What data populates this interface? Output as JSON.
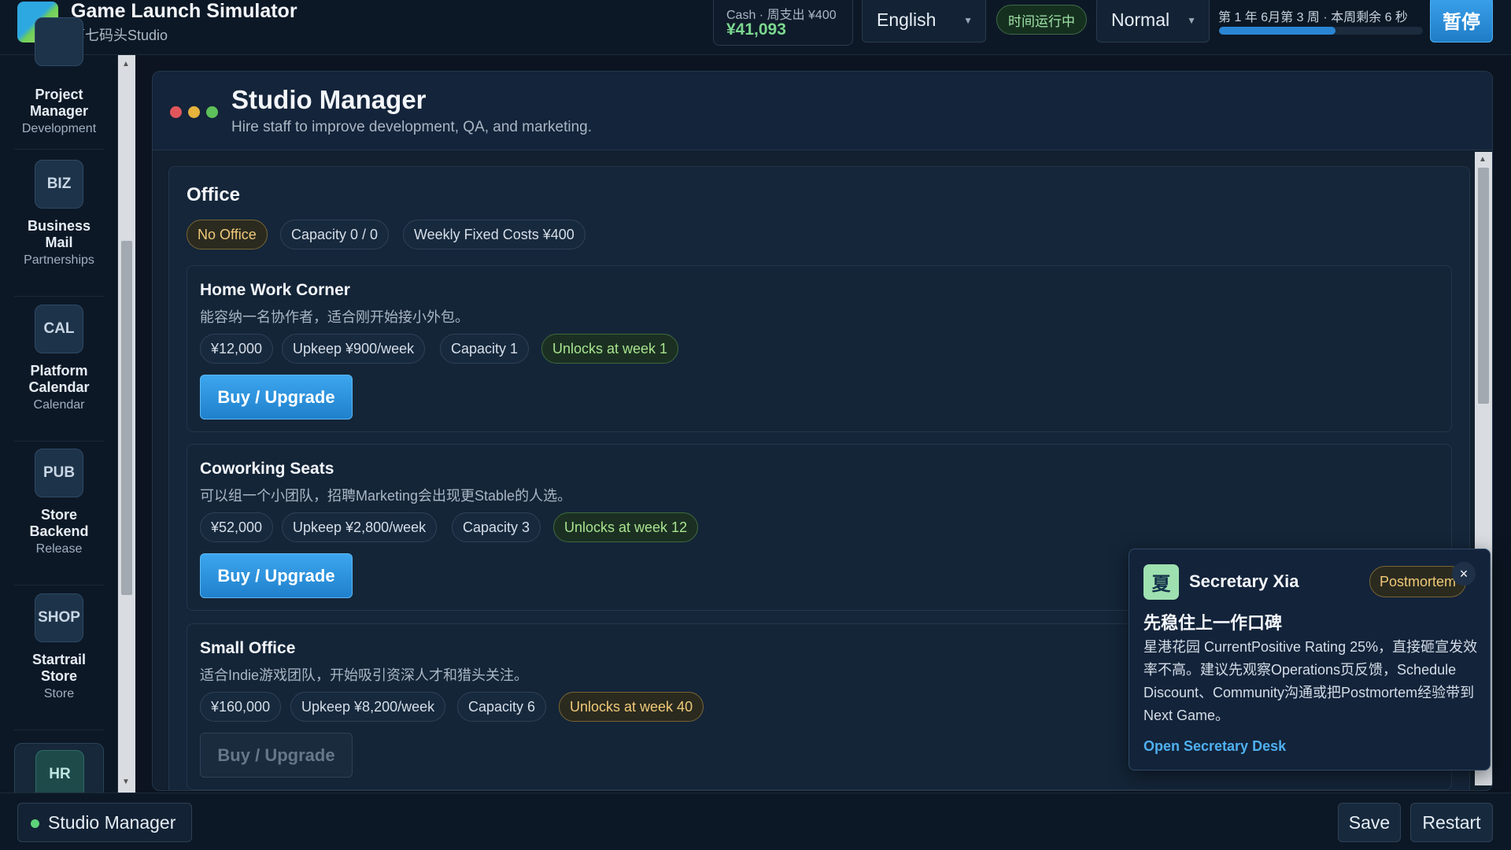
{
  "app": {
    "title": "Game Launch Simulator",
    "studio": "第七码头Studio"
  },
  "topbar": {
    "cash_label": "Cash · 周支出 ¥400",
    "cash_value": "¥41,093",
    "language": "English",
    "run_status": "时间运行中",
    "speed": "Normal",
    "time_text": "第 1 年 6月第 3 周 · 本周剩余 6 秒",
    "week_progress_percent": 57,
    "pause_label": "暂停"
  },
  "sidebar": {
    "items": [
      {
        "icon": "",
        "name": "Project Manager",
        "category": "Development"
      },
      {
        "icon": "BIZ",
        "name": "Business Mail",
        "category": "Partnerships"
      },
      {
        "icon": "CAL",
        "name": "Platform Calendar",
        "category": "Calendar"
      },
      {
        "icon": "PUB",
        "name": "Store Backend",
        "category": "Release"
      },
      {
        "icon": "SHOP",
        "name": "Startrail Store",
        "category": "Store"
      },
      {
        "icon": "HR",
        "name": "",
        "category": ""
      }
    ]
  },
  "panel": {
    "title": "Studio Manager",
    "subtitle": "Hire staff to improve development, QA, and marketing.",
    "dot_colors": [
      "#e0565b",
      "#e6b33c",
      "#5ec05a"
    ]
  },
  "office": {
    "title": "Office",
    "status": "No Office",
    "capacity": "Capacity 0 / 0",
    "fixed_costs": "Weekly Fixed Costs ¥400",
    "tiers": [
      {
        "name": "Home Work Corner",
        "desc": "能容纳一名协作者，适合刚开始接小外包。",
        "price": "¥12,000",
        "upkeep": "Upkeep ¥900/week",
        "capacity": "Capacity 1",
        "unlock": "Unlocks at week 1",
        "button": "Buy / Upgrade"
      },
      {
        "name": "Coworking Seats",
        "desc": "可以组一个小团队，招聘Marketing会出现更Stable的人选。",
        "price": "¥52,000",
        "upkeep": "Upkeep ¥2,800/week",
        "capacity": "Capacity 3",
        "unlock": "Unlocks at week 12",
        "button": "Buy / Upgrade"
      },
      {
        "name": "Small Office",
        "desc": "适合Indie游戏团队，开始吸引资深人才和猎头关注。",
        "price": "¥160,000",
        "upkeep": "Upkeep ¥8,200/week",
        "capacity": "Capacity 6",
        "unlock": "Unlocks at week 40",
        "button": "Buy / Upgrade"
      }
    ]
  },
  "secretary": {
    "avatar": "夏",
    "name": "Secretary Xia",
    "tag": "Postmortem",
    "close": "×",
    "headline": "先稳住上一作口碑",
    "body": "星港花园 CurrentPositive Rating 25%，直接砸宣发效率不高。建议先观察Operations页反馈，Schedule Discount、Community沟通或把Postmortem经验带到Next Game。",
    "link": "Open Secretary Desk"
  },
  "bottombar": {
    "task_label": "Studio Manager",
    "save_label": "Save",
    "restart_label": "Restart"
  }
}
